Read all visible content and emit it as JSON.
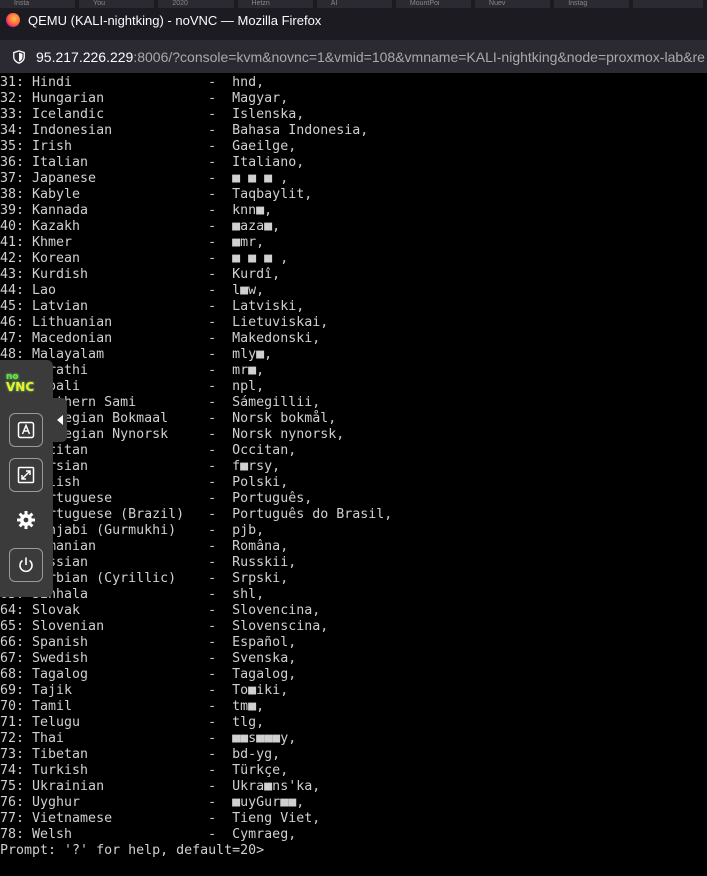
{
  "browser": {
    "window_title": "QEMU (KALI-nightking) - noVNC — Mozilla Firefox",
    "tabs": [
      "Insta",
      "You",
      "2020",
      "Hetzn",
      "AI",
      "MountPoi",
      "Nuev",
      "Instag",
      ""
    ],
    "url_host": "95.217.226.229",
    "url_rest": ":8006/?console=kvm&novnc=1&vmid=108&vmname=KALI-nightking&node=proxmox-lab&re"
  },
  "novnc": {
    "logo_no": "no",
    "logo_vnc": "VNC",
    "icons": [
      "keyboard-icon",
      "fullscreen-icon",
      "gear-icon",
      "power-icon"
    ],
    "accent": "#f4f12a"
  },
  "console": {
    "lines": [
      "31: Hindi                 -  hnd,",
      "32: Hungarian             -  Magyar,",
      "33: Icelandic             -  Islenska,",
      "34: Indonesian            -  Bahasa Indonesia,",
      "35: Irish                 -  Gaeilge,",
      "36: Italian               -  Italiano,",
      "37: Japanese              -  ■ ■ ■ ,",
      "38: Kabyle                -  Taqbaylit,",
      "39: Kannada               -  knn■,",
      "40: Kazakh                -  ■aza■,",
      "41: Khmer                 -  ■mr,",
      "42: Korean                -  ■ ■ ■ ,",
      "43: Kurdish               -  Kurdî,",
      "44: Lao                   -  l■w,",
      "45: Latvian               -  Latviski,",
      "46: Lithuanian            -  Lietuviskai,",
      "47: Macedonian            -  Makedonski,",
      "48: Malayalam             -  mly■,",
      "49: Marathi               -  mr■,",
      "50: Nepali                -  npl,",
      "51: Northern Sami         -  Sámegillii,",
      "52: Norwegian Bokmaal     -  Norsk bokmål,",
      "53: Norwegian Nynorsk     -  Norsk nynorsk,",
      "54: Occitan               -  Occitan,",
      "55: Persian               -  f■rsy,",
      "56: Polish                -  Polski,",
      "57: Portuguese            -  Português,",
      "58: Portuguese (Brazil)   -  Português do Brasil,",
      "59: Punjabi (Gurmukhi)    -  pjb,",
      "60: Romanian              -  Româna,",
      "61: Russian               -  Russkii,",
      "62: Serbian (Cyrillic)    -  Srpski,",
      "63: Sinhala               -  shl,",
      "64: Slovak                -  Slovencina,",
      "65: Slovenian             -  Slovenscina,",
      "66: Spanish               -  Español,",
      "67: Swedish               -  Svenska,",
      "68: Tagalog               -  Tagalog,",
      "69: Tajik                 -  To■iki,",
      "70: Tamil                 -  tm■,",
      "71: Telugu                -  tlg,",
      "72: Thai                  -  ■■s■■■y,",
      "73: Tibetan               -  bd-yg,",
      "74: Turkish               -  Türkçe,",
      "75: Ukrainian             -  Ukra■ns'ka,",
      "76: Uyghur                -  ■uyGur■■,",
      "77: Vietnamese            -  Tieng Viet,",
      "78: Welsh                 -  Cymraeg,"
    ],
    "prompt": "Prompt: '?' for help, default=20>"
  }
}
